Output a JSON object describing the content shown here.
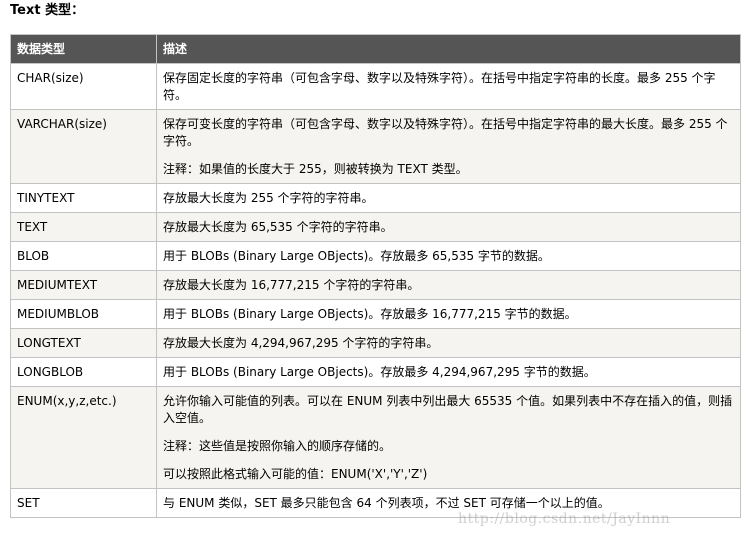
{
  "heading": "Text 类型：",
  "table": {
    "headers": [
      "数据类型",
      "描述"
    ],
    "rows": [
      {
        "type": "CHAR(size)",
        "desc": [
          "保存固定长度的字符串（可包含字母、数字以及特殊字符）。在括号中指定字符串的长度。最多 255 个字符。"
        ]
      },
      {
        "type": "VARCHAR(size)",
        "desc": [
          "保存可变长度的字符串（可包含字母、数字以及特殊字符）。在括号中指定字符串的最大长度。最多 255 个字符。",
          "注释：如果值的长度大于 255，则被转换为 TEXT 类型。"
        ]
      },
      {
        "type": "TINYTEXT",
        "desc": [
          "存放最大长度为 255 个字符的字符串。"
        ]
      },
      {
        "type": "TEXT",
        "desc": [
          "存放最大长度为 65,535 个字符的字符串。"
        ]
      },
      {
        "type": "BLOB",
        "desc": [
          "用于 BLOBs (Binary Large OBjects)。存放最多 65,535 字节的数据。"
        ]
      },
      {
        "type": "MEDIUMTEXT",
        "desc": [
          "存放最大长度为 16,777,215 个字符的字符串。"
        ]
      },
      {
        "type": "MEDIUMBLOB",
        "desc": [
          "用于 BLOBs (Binary Large OBjects)。存放最多 16,777,215 字节的数据。"
        ]
      },
      {
        "type": "LONGTEXT",
        "desc": [
          "存放最大长度为 4,294,967,295 个字符的字符串。"
        ]
      },
      {
        "type": "LONGBLOB",
        "desc": [
          "用于 BLOBs (Binary Large OBjects)。存放最多 4,294,967,295 字节的数据。"
        ]
      },
      {
        "type": "ENUM(x,y,z,etc.)",
        "desc": [
          "允许你输入可能值的列表。可以在 ENUM 列表中列出最大 65535 个值。如果列表中不存在插入的值，则插入空值。",
          "注释：这些值是按照你输入的顺序存储的。",
          "可以按照此格式输入可能的值：ENUM('X','Y','Z')"
        ]
      },
      {
        "type": "SET",
        "desc": [
          "与 ENUM 类似，SET 最多只能包含 64 个列表项，不过 SET 可存储一个以上的值。"
        ]
      }
    ]
  },
  "watermark": "http://blog.csdn.net/JayInnn"
}
